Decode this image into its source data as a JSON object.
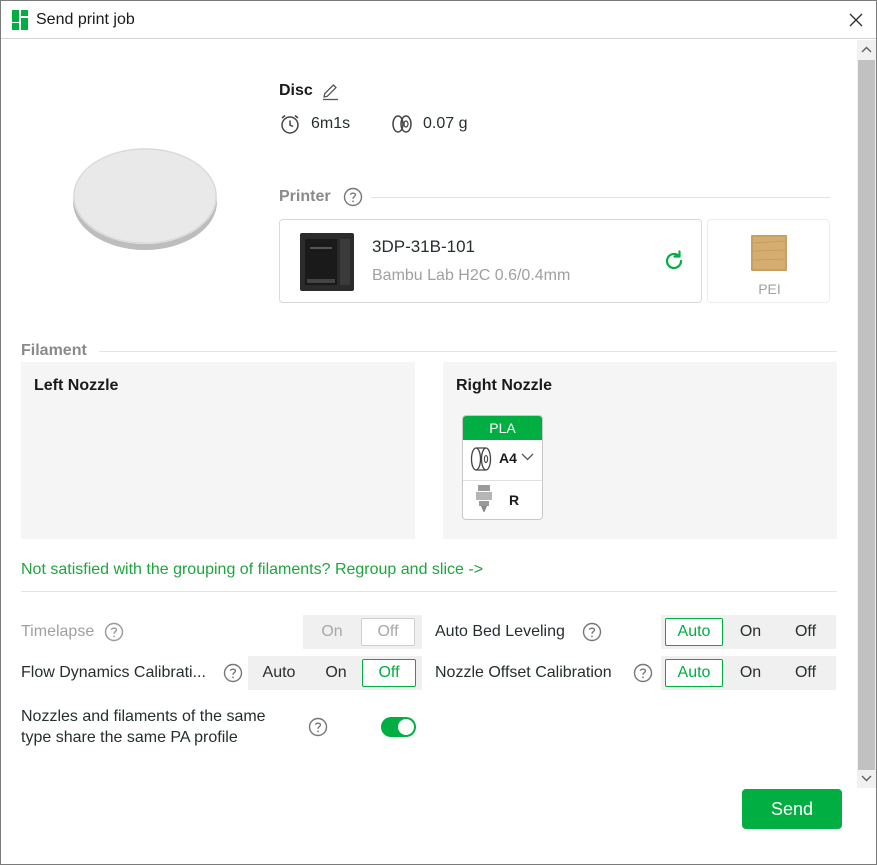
{
  "window": {
    "title": "Send print job"
  },
  "model": {
    "name": "Disc",
    "time": "6m1s",
    "weight": "0.07 g"
  },
  "printer_section": {
    "label": "Printer",
    "printer_name": "3DP-31B-101",
    "printer_model": "Bambu Lab H2C  0.6/0.4mm",
    "plate_label": "PEI"
  },
  "filament_section": {
    "label": "Filament",
    "left_nozzle_title": "Left Nozzle",
    "right_nozzle_title": "Right Nozzle",
    "right_filament": {
      "type": "PLA",
      "slot": "A4",
      "nozzle": "R"
    }
  },
  "regroup_link": "Not satisfied with the grouping of filaments? Regroup and slice ->",
  "options": {
    "timelapse": {
      "label": "Timelapse",
      "on": "On",
      "off": "Off",
      "selected": "Off",
      "enabled": false
    },
    "auto_bed_leveling": {
      "label": "Auto Bed Leveling",
      "auto": "Auto",
      "on": "On",
      "off": "Off",
      "selected": "Auto"
    },
    "flow_dynamics": {
      "label": "Flow Dynamics Calibrati...",
      "auto": "Auto",
      "on": "On",
      "off": "Off",
      "selected": "Off"
    },
    "nozzle_offset": {
      "label": "Nozzle Offset Calibration",
      "auto": "Auto",
      "on": "On",
      "off": "Off",
      "selected": "Auto"
    },
    "share_pa": {
      "label_line1": "Nozzles and filaments of the same",
      "label_line2": "type share the same PA profile",
      "value": true
    }
  },
  "buttons": {
    "send": "Send"
  },
  "colors": {
    "accent": "#00ae42",
    "link": "#1fa53d",
    "plate": "#c9a063"
  }
}
